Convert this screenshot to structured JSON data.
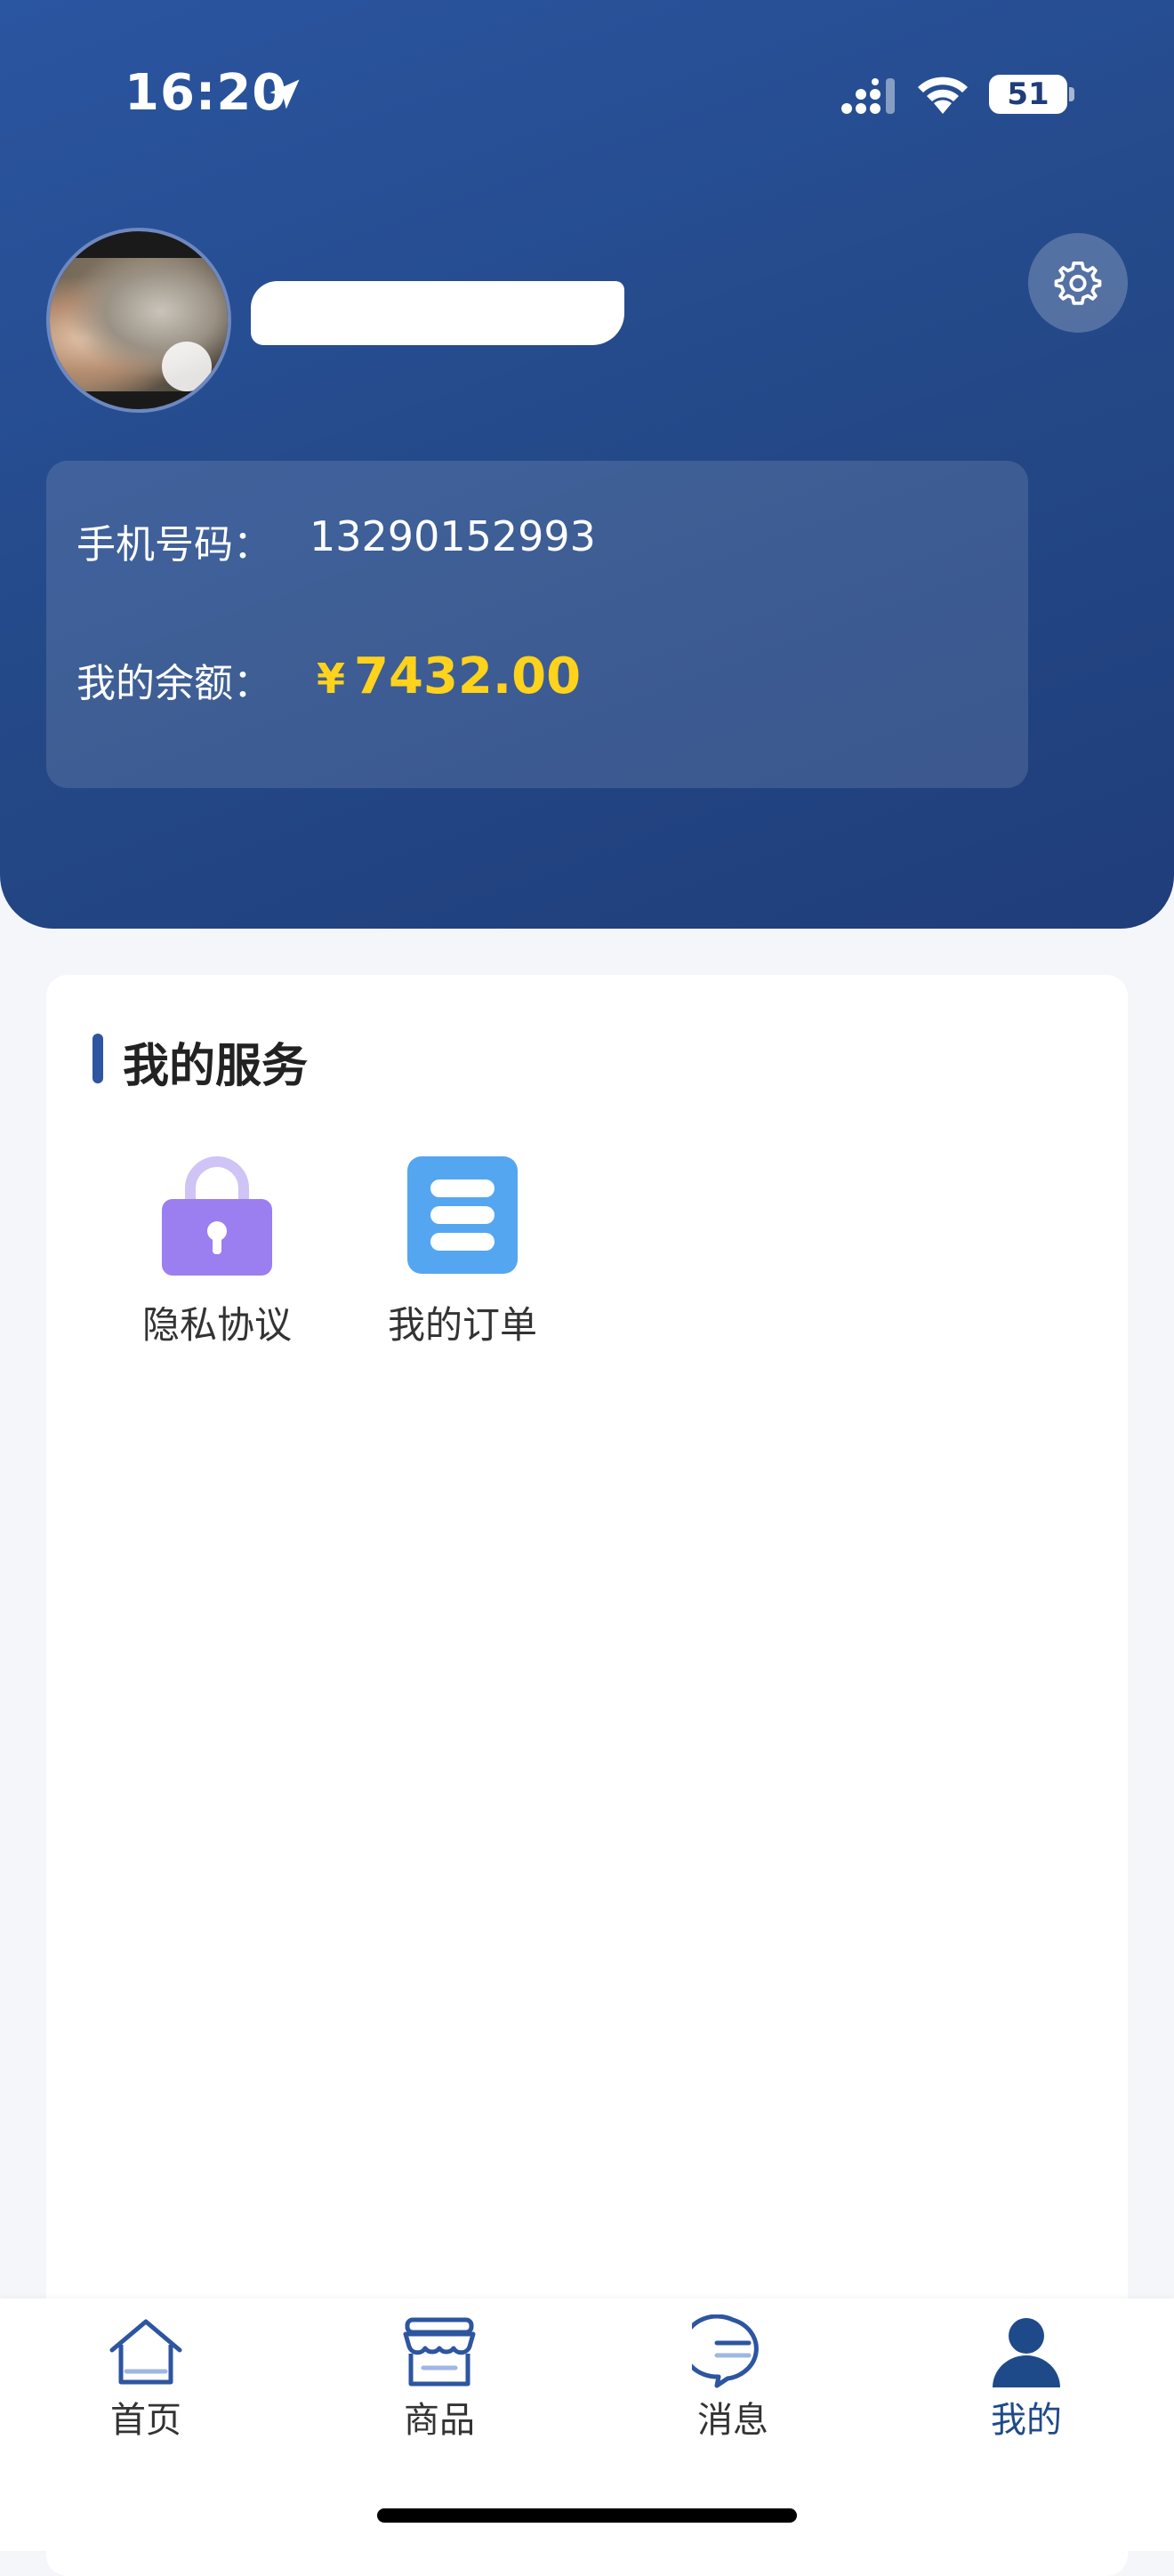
{
  "status_bar": {
    "time": "16:20",
    "battery": "51"
  },
  "profile": {
    "phone_label": "手机号码：",
    "phone_value": "13290152993",
    "balance_label": "我的余额：",
    "balance_currency": "¥",
    "balance_value": "7432.00"
  },
  "services": {
    "title": "我的服务",
    "items": [
      {
        "label": "隐私协议",
        "icon": "lock-icon"
      },
      {
        "label": "我的订单",
        "icon": "list-icon"
      }
    ]
  },
  "tabbar": {
    "items": [
      {
        "label": "首页",
        "icon": "home-icon"
      },
      {
        "label": "商品",
        "icon": "store-icon"
      },
      {
        "label": "消息",
        "icon": "message-icon"
      },
      {
        "label": "我的",
        "icon": "user-icon",
        "active": true
      }
    ]
  },
  "colors": {
    "header": "#244887",
    "accent": "#2d55a0",
    "balance": "#ffd21c",
    "active_tab": "#1f4a8a"
  }
}
